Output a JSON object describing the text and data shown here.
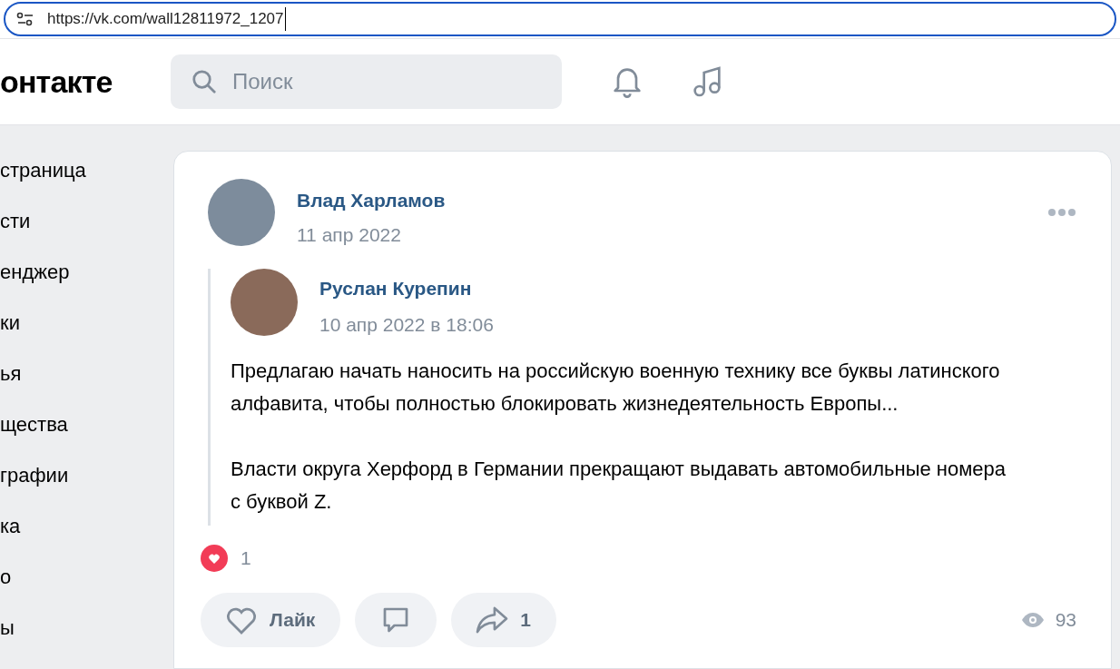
{
  "address_bar": {
    "url": "https://vk.com/wall12811972_1207"
  },
  "header": {
    "logo": "онтакте",
    "search": {
      "placeholder": "Поиск"
    }
  },
  "sidebar": {
    "items": [
      {
        "label": "страница"
      },
      {
        "label": "сти"
      },
      {
        "label": "енджер"
      },
      {
        "label": "ки"
      },
      {
        "label": "ья"
      },
      {
        "label": "щества"
      },
      {
        "label": "графии"
      },
      {
        "label": "ка"
      },
      {
        "label": "о"
      },
      {
        "label": "ы"
      }
    ]
  },
  "post": {
    "author": "Влад Харламов",
    "date": "11 апр 2022",
    "repost": {
      "author": "Руслан Курепин",
      "date": "10 апр 2022 в 18:06",
      "paragraphs": [
        "Предлагаю начать наносить на российскую военную технику все буквы латинского алфавита, чтобы полностью блокировать жизнедеятельность Европы...",
        "Власти округа Херфорд в Германии прекращают выдавать автомобильные номера с буквой Z."
      ]
    },
    "reactions": {
      "count": "1"
    },
    "actions": [
      {
        "kind": "like",
        "label": "Лайк"
      },
      {
        "kind": "comment"
      },
      {
        "kind": "share",
        "label": "1"
      }
    ],
    "views": "93"
  }
}
